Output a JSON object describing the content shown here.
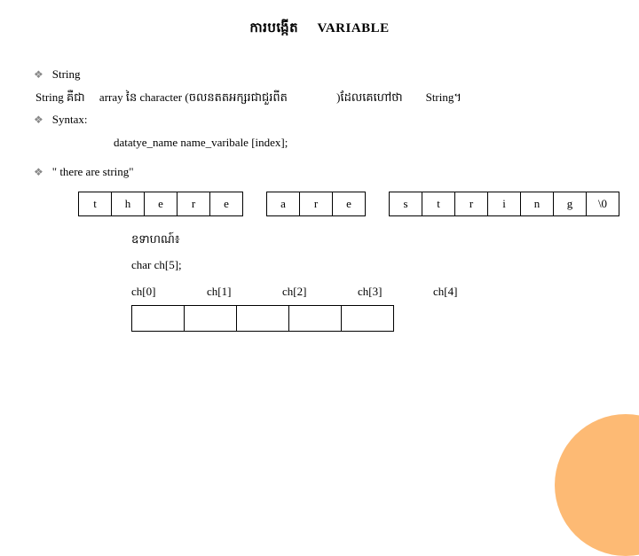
{
  "title_left": "ការបង្កើត",
  "title_right": "VARIABLE",
  "bullets": {
    "b1": "String",
    "desc_prefix": "String គឺជា",
    "desc_mid": "array នៃ character (ចលនតតអក្សរជាជួរពីត",
    "desc_paren": ")ដែលគេហៅថា",
    "desc_end": "String។",
    "b2": "Syntax:",
    "syntax_code": "datatye_name name_varibale [index];",
    "b3": "\" there are string\""
  },
  "chars": {
    "c0": "t",
    "c1": "h",
    "c2": "e",
    "c3": "r",
    "c4": "e",
    "c5": "a",
    "c6": "r",
    "c7": "e",
    "c8": "s",
    "c9": "t",
    "c10": "r",
    "c11": "i",
    "c12": "n",
    "c13": "g",
    "c14": "\\0"
  },
  "example": {
    "label": "ឧទាហណ៍៖",
    "decl": "char ch[5];",
    "idx0": "ch[0]",
    "idx1": "ch[1]",
    "idx2": "ch[2]",
    "idx3": "ch[3]",
    "idx4": "ch[4]"
  }
}
